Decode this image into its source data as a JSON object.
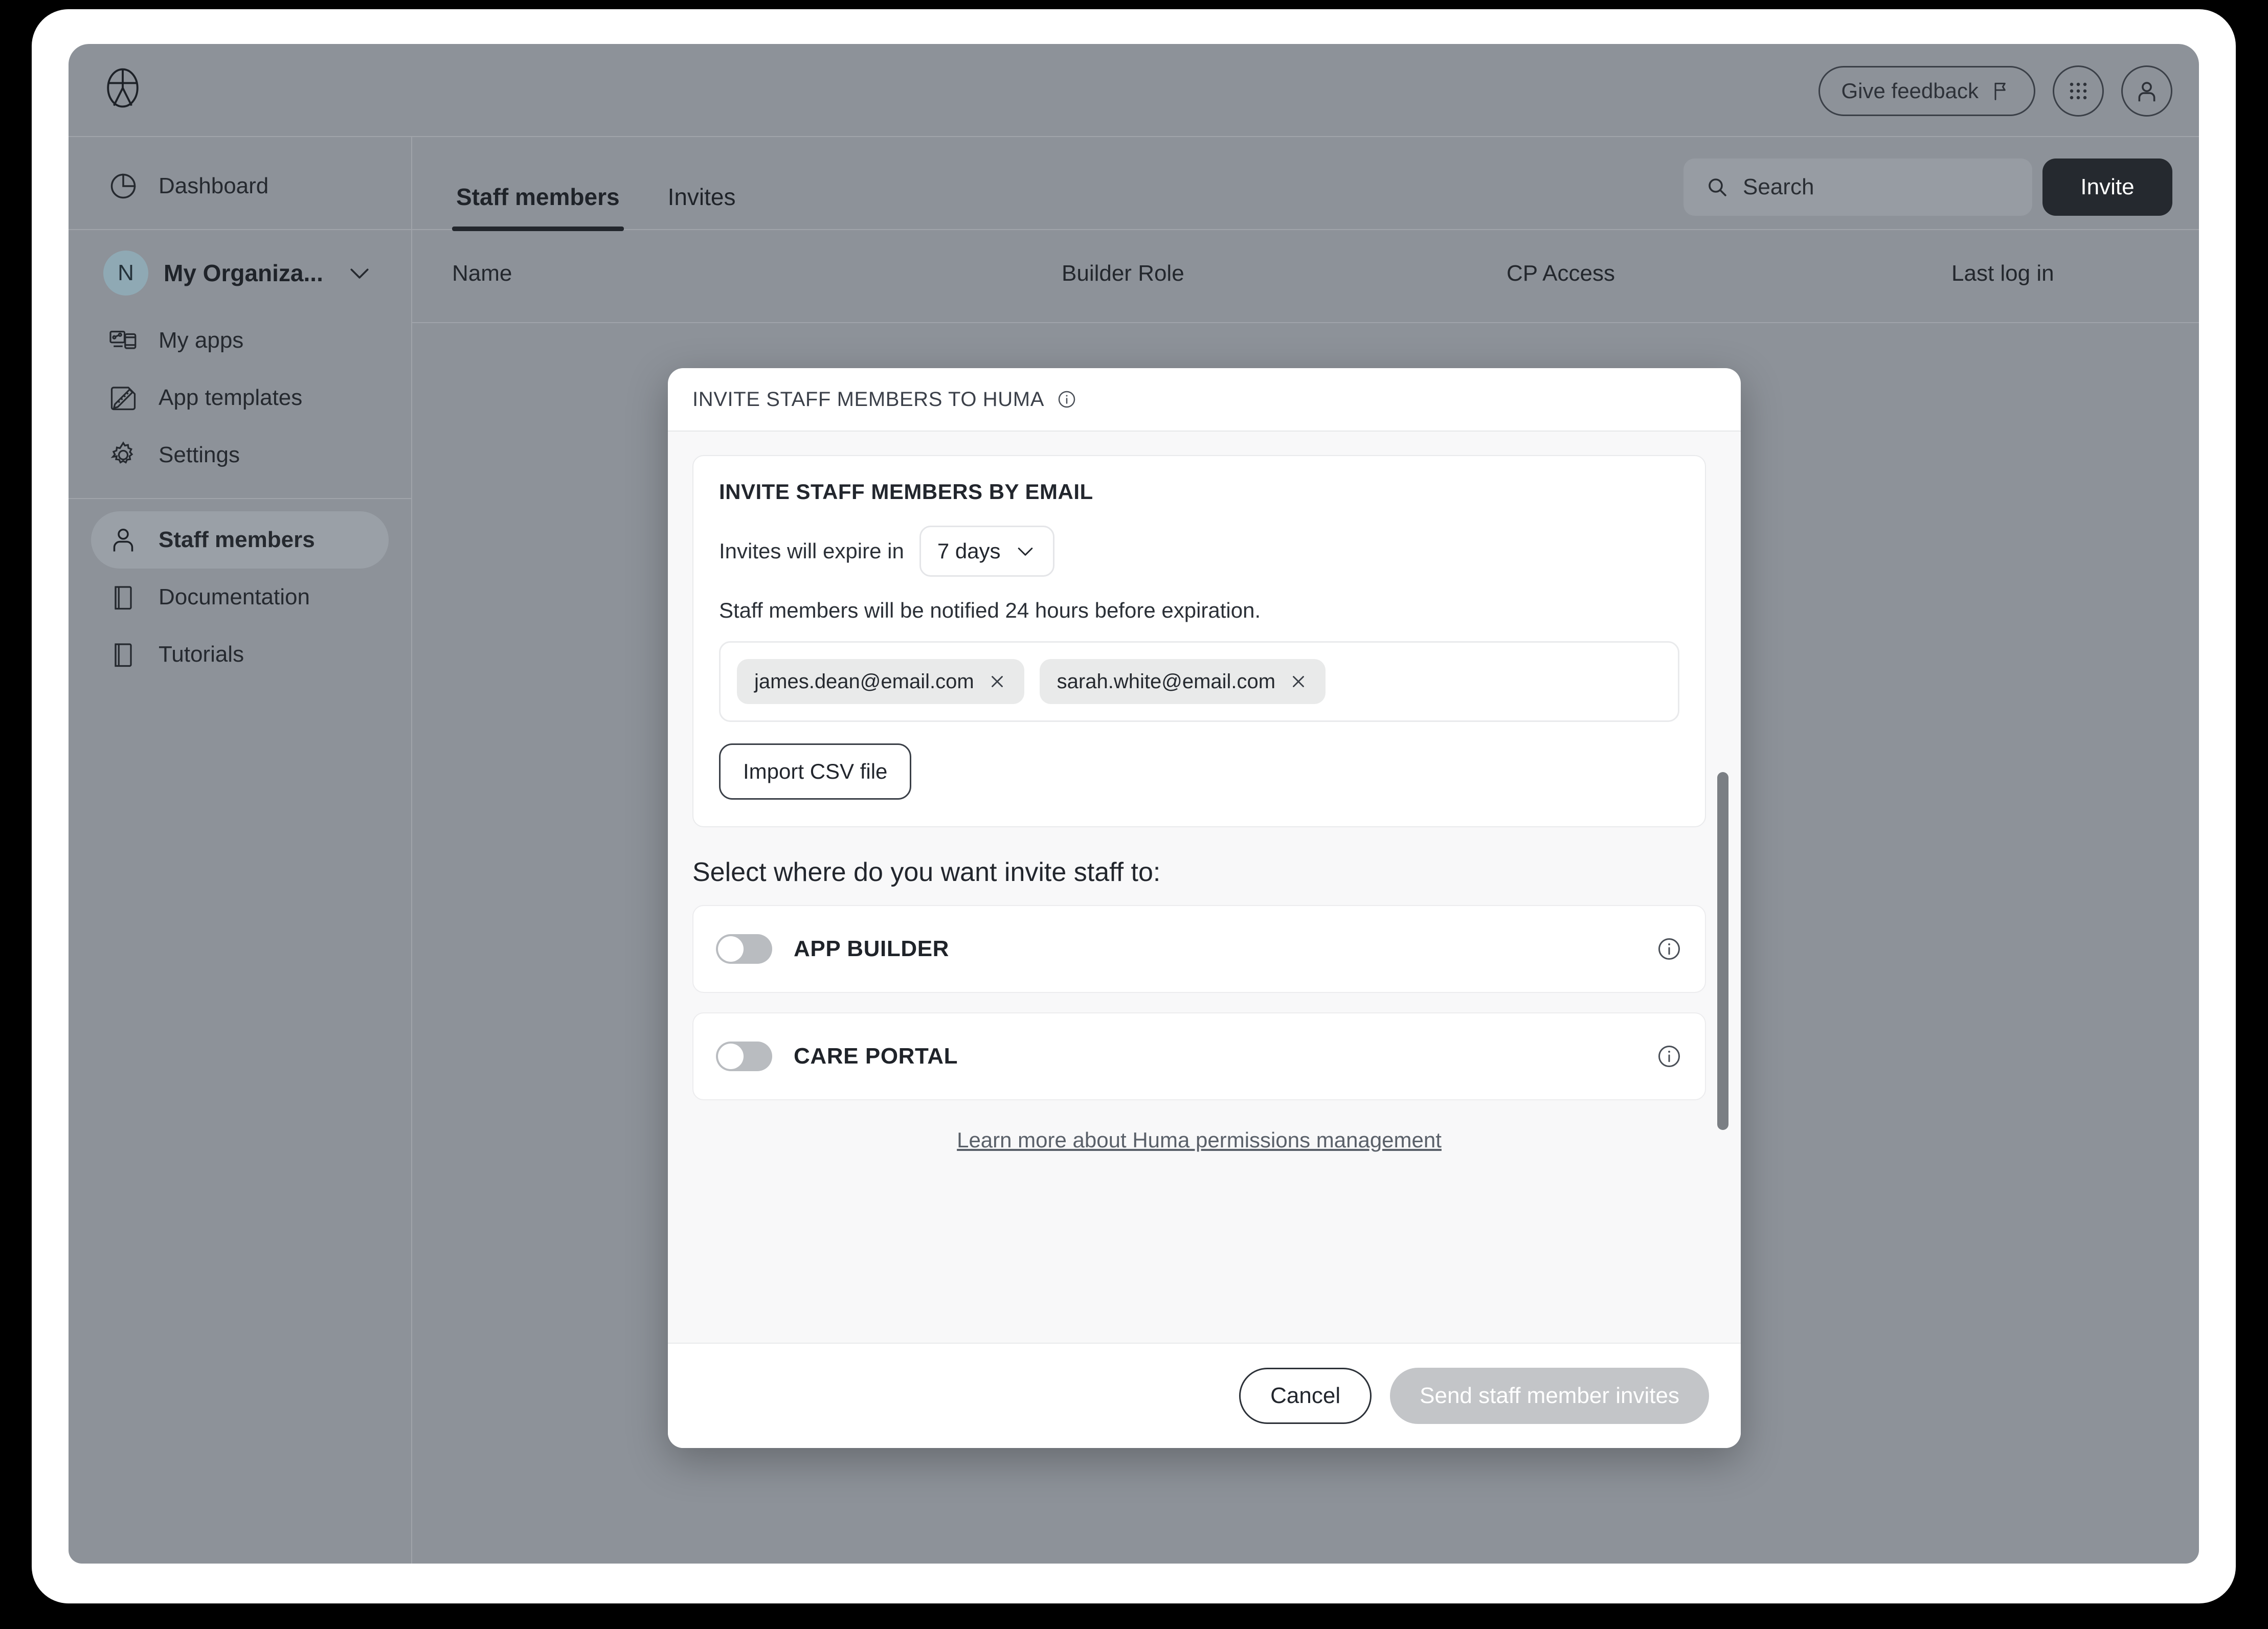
{
  "app": {
    "brand_logo_icon": "huma-logo-icon"
  },
  "topbar": {
    "feedback_label": "Give feedback",
    "feedback_icon": "flag-icon",
    "apps_grid_icon": "apps-grid-icon",
    "account_icon": "user-avatar-icon"
  },
  "sidebar": {
    "dashboard": {
      "label": "Dashboard",
      "icon": "pie-chart-icon"
    },
    "org": {
      "avatar_initial": "N",
      "name": "My Organiza...",
      "chevron_icon": "chevron-down-icon"
    },
    "items": [
      {
        "label": "My apps",
        "icon": "devices-icon",
        "active": false
      },
      {
        "label": "App templates",
        "icon": "ruler-pencil-icon",
        "active": false
      },
      {
        "label": "Settings",
        "icon": "gear-icon",
        "active": false
      },
      {
        "label": "Staff members",
        "icon": "person-icon",
        "active": true
      },
      {
        "label": "Documentation",
        "icon": "book-icon",
        "active": false
      },
      {
        "label": "Tutorials",
        "icon": "book-icon",
        "active": false
      }
    ]
  },
  "main": {
    "tabs": [
      {
        "label": "Staff members",
        "active": true
      },
      {
        "label": "Invites",
        "active": false
      }
    ],
    "search": {
      "placeholder": "Search",
      "value": "",
      "icon": "search-icon"
    },
    "invite_button": "Invite",
    "table": {
      "columns": [
        "Name",
        "Builder Role",
        "CP Access",
        "Last log in"
      ],
      "rows": []
    }
  },
  "modal": {
    "header": {
      "title": "INVITE STAFF MEMBERS TO HUMA",
      "info_icon": "info-circle-icon"
    },
    "email_card": {
      "title": "INVITE STAFF MEMBERS BY EMAIL",
      "expire_label": "Invites will expire in",
      "expire_value": "7 days",
      "expire_chevron_icon": "chevron-down-icon",
      "expire_options": [
        "7 days"
      ],
      "notify_text": "Staff members will be notified 24 hours before expiration.",
      "email_chips": [
        {
          "email": "james.dean@email.com",
          "remove_icon": "close-icon"
        },
        {
          "email": "sarah.white@email.com",
          "remove_icon": "close-icon"
        }
      ],
      "import_button": "Import CSV file"
    },
    "destination": {
      "heading": "Select where do you want invite staff to:",
      "options": [
        {
          "label": "APP BUILDER",
          "enabled": false,
          "info_icon": "info-circle-icon"
        },
        {
          "label": "CARE PORTAL",
          "enabled": false,
          "info_icon": "info-circle-icon"
        }
      ],
      "learn_more_link": "Learn more about Huma permissions management"
    },
    "footer": {
      "cancel_label": "Cancel",
      "submit_label": "Send staff member invites",
      "submit_disabled": true
    },
    "scrollbar": {
      "visible": true
    }
  },
  "colors": {
    "page_background": "#000000",
    "window_chrome": "#ffffff",
    "app_background": "#8d9299",
    "accent_dark": "#25292f",
    "modal_background": "#ffffff",
    "modal_body_background": "#f8f8f9",
    "chip_background": "#e9eaea",
    "disabled_button": "#c3c5c8",
    "org_avatar": "#8fa9b4"
  }
}
